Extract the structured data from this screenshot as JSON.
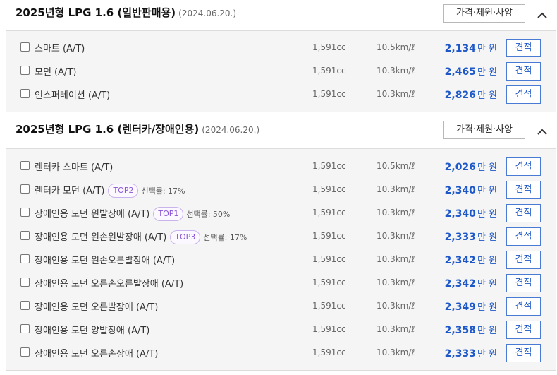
{
  "sections": [
    {
      "title": "2025년형 LPG 1.6 (일반판매용)",
      "date": "(2024.06.20.)",
      "spec_label": "가격·제원·사양",
      "trims": [
        {
          "name": "스마트 (A/T)",
          "cc": "1,591cc",
          "eff": "10.5km/ℓ",
          "price": "2,134",
          "unit": "만 원",
          "quote": "견적",
          "badge": "",
          "rate": ""
        },
        {
          "name": "모던 (A/T)",
          "cc": "1,591cc",
          "eff": "10.3km/ℓ",
          "price": "2,465",
          "unit": "만 원",
          "quote": "견적",
          "badge": "",
          "rate": ""
        },
        {
          "name": "인스퍼레이션 (A/T)",
          "cc": "1,591cc",
          "eff": "10.3km/ℓ",
          "price": "2,826",
          "unit": "만 원",
          "quote": "견적",
          "badge": "",
          "rate": ""
        }
      ]
    },
    {
      "title": "2025년형 LPG 1.6 (렌터카/장애인용)",
      "date": "(2024.06.20.)",
      "spec_label": "가격·제원·사양",
      "trims": [
        {
          "name": "렌터카 스마트 (A/T)",
          "cc": "1,591cc",
          "eff": "10.5km/ℓ",
          "price": "2,026",
          "unit": "만 원",
          "quote": "견적",
          "badge": "",
          "rate": ""
        },
        {
          "name": "렌터카 모던 (A/T)",
          "cc": "1,591cc",
          "eff": "10.3km/ℓ",
          "price": "2,340",
          "unit": "만 원",
          "quote": "견적",
          "badge": "TOP2",
          "rate": "선택률: 17%"
        },
        {
          "name": "장애인용 모던 왼발장애 (A/T)",
          "cc": "1,591cc",
          "eff": "10.3km/ℓ",
          "price": "2,340",
          "unit": "만 원",
          "quote": "견적",
          "badge": "TOP1",
          "rate": "선택률: 50%"
        },
        {
          "name": "장애인용 모던 왼손왼발장애 (A/T)",
          "cc": "1,591cc",
          "eff": "10.3km/ℓ",
          "price": "2,333",
          "unit": "만 원",
          "quote": "견적",
          "badge": "TOP3",
          "rate": "선택률: 17%"
        },
        {
          "name": "장애인용 모던 왼손오른발장애 (A/T)",
          "cc": "1,591cc",
          "eff": "10.3km/ℓ",
          "price": "2,342",
          "unit": "만 원",
          "quote": "견적",
          "badge": "",
          "rate": ""
        },
        {
          "name": "장애인용 모던 오른손오른발장애 (A/T)",
          "cc": "1,591cc",
          "eff": "10.3km/ℓ",
          "price": "2,342",
          "unit": "만 원",
          "quote": "견적",
          "badge": "",
          "rate": ""
        },
        {
          "name": "장애인용 모던 오른발장애 (A/T)",
          "cc": "1,591cc",
          "eff": "10.3km/ℓ",
          "price": "2,349",
          "unit": "만 원",
          "quote": "견적",
          "badge": "",
          "rate": ""
        },
        {
          "name": "장애인용 모던 양발장애 (A/T)",
          "cc": "1,591cc",
          "eff": "10.3km/ℓ",
          "price": "2,358",
          "unit": "만 원",
          "quote": "견적",
          "badge": "",
          "rate": ""
        },
        {
          "name": "장애인용 모던 오른손장애 (A/T)",
          "cc": "1,591cc",
          "eff": "10.3km/ℓ",
          "price": "2,333",
          "unit": "만 원",
          "quote": "견적",
          "badge": "",
          "rate": ""
        }
      ]
    }
  ],
  "colors": {
    "price": "#1d57c8",
    "badge": "#8a55d6",
    "row_bg": "#f5f5f5"
  },
  "icons": {
    "collapse": "chevron-up-icon",
    "select": "checkbox-icon"
  }
}
